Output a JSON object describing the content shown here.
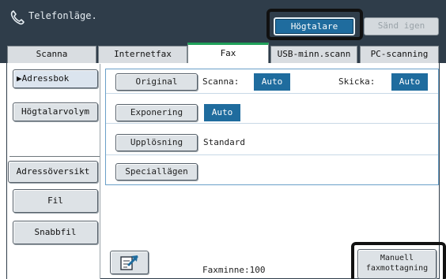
{
  "header": {
    "title": "Telefonläge.",
    "speaker_button": "Högtalare",
    "resend_button": "Sänd igen"
  },
  "tabs": [
    {
      "label": "Scanna"
    },
    {
      "label": "Internetfax"
    },
    {
      "label": "Fax",
      "active": true
    },
    {
      "label": "USB-minn.scann"
    },
    {
      "label": "PC-scanning"
    }
  ],
  "sidebar": {
    "address_book": "Adressbok",
    "speaker_volume": "Högtalarvolym",
    "address_review": "Adressöversikt",
    "file": "Fil",
    "quick_file": "Snabbfil"
  },
  "options": {
    "original_button": "Original",
    "scan_label": "Scanna:",
    "scan_value": "Auto",
    "send_label": "Skicka:",
    "send_value": "Auto",
    "exposure_button": "Exponering",
    "exposure_value": "Auto",
    "resolution_button": "Upplösning",
    "resolution_value": "Standard",
    "special_modes_button": "Speciallägen"
  },
  "footer": {
    "memory": "Faxminne:100",
    "manual_reception_line1": "Manuell",
    "manual_reception_line2": "faxmottagning"
  },
  "colors": {
    "title_bar": "#2f3d4a",
    "accent_blue": "#1f6c9e",
    "active_tab_accent": "#20a05a"
  },
  "icons": {
    "phone": "phone-icon",
    "send_setup": "send-arrow-icon"
  }
}
